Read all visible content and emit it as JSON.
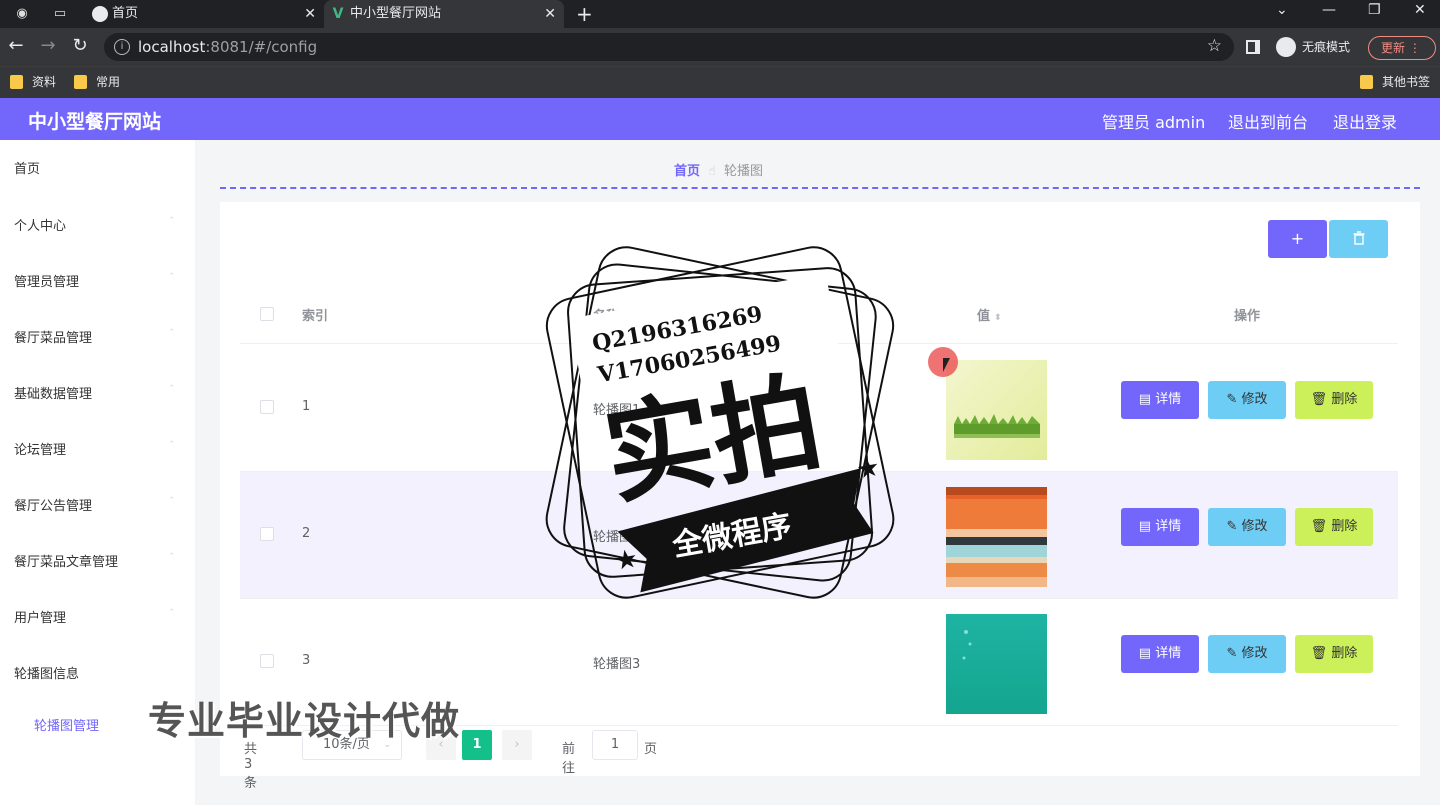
{
  "browser": {
    "tabs": [
      {
        "title": "首页"
      },
      {
        "title": "中小型餐厅网站"
      }
    ],
    "url_host": "localhost",
    "url_rest": ":8081/#/config",
    "incognito_label": "无痕模式",
    "update_label": "更新",
    "bookmarks": [
      "资料",
      "常用"
    ],
    "other_bookmarks": "其他书签"
  },
  "header": {
    "title": "中小型餐厅网站",
    "admin_label": "管理员 admin",
    "front_label": "退出到前台",
    "logout_label": "退出登录"
  },
  "sidebar": {
    "items": [
      {
        "label": "首页"
      },
      {
        "label": "个人中心"
      },
      {
        "label": "管理员管理"
      },
      {
        "label": "餐厅菜品管理"
      },
      {
        "label": "基础数据管理"
      },
      {
        "label": "论坛管理"
      },
      {
        "label": "餐厅公告管理"
      },
      {
        "label": "餐厅菜品文章管理"
      },
      {
        "label": "用户管理"
      },
      {
        "label": "轮播图信息"
      }
    ],
    "sub_item": "轮播图管理"
  },
  "breadcrumb": {
    "home": "首页",
    "current": "轮播图"
  },
  "toolbar": {
    "add_label": "+",
    "delete_icon": "trash-icon"
  },
  "table": {
    "columns": [
      "索引",
      "名称",
      "值",
      "操作"
    ],
    "rows": [
      {
        "index": "1",
        "name": "轮播图1",
        "image": "grass-image"
      },
      {
        "index": "2",
        "name": "轮播图2",
        "image": "stripes-image"
      },
      {
        "index": "3",
        "name": "轮播图3",
        "image": "teal-image"
      }
    ],
    "actions": {
      "detail": "详情",
      "edit": "修改",
      "remove": "删除"
    }
  },
  "pagination": {
    "total": "共 3 条",
    "page_size": "10条/页",
    "current": "1",
    "goto_label": "前往",
    "goto_value": "1",
    "unit": "页"
  },
  "overlay": {
    "stamp_line1": "Q2196316269",
    "stamp_line2": "V17060256499",
    "stamp_main": "实拍",
    "stamp_banner": "全微程序",
    "caption": "专业毕业设计代做"
  },
  "colors": {
    "accent": "#7266fb",
    "info": "#6ecdf5",
    "lime": "#cbf05a",
    "page_active": "#13c08a"
  }
}
